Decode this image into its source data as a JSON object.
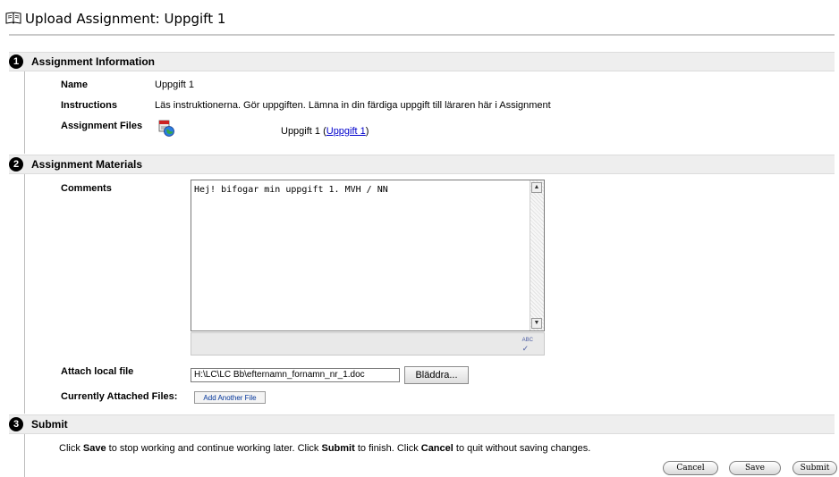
{
  "page": {
    "title": "Upload Assignment: Uppgift 1",
    "icon": "open-book-icon"
  },
  "sections": {
    "info": {
      "number": "1",
      "title": "Assignment Information"
    },
    "materials": {
      "number": "2",
      "title": "Assignment Materials"
    },
    "submit": {
      "number": "3",
      "title": "Submit"
    }
  },
  "info": {
    "name_label": "Name",
    "name_value": "Uppgift 1",
    "instructions_label": "Instructions",
    "instructions_value": "Läs instruktionerna. Gör uppgiften. Lämna in din färdiga uppgift till läraren här i Assignment",
    "files_label": "Assignment Files",
    "file_text": "Uppgift 1 (",
    "file_link": "Uppgift 1",
    "file_text_end": ")"
  },
  "materials": {
    "comments_label": "Comments",
    "comments_value": "Hej! bifogar min uppgift 1. MVH / NN",
    "attach_label": "Attach local file",
    "attach_value": "H:\\LC\\LC Bb\\efternamn_fornamn_nr_1.doc",
    "browse_label": "Bläddra...",
    "attached_label": "Currently Attached Files:",
    "add_file_label": "Add Another File",
    "spell_icon_text": "ABC"
  },
  "submit": {
    "instr_1": "Click ",
    "instr_save": "Save",
    "instr_2": " to stop working and continue working later. Click ",
    "instr_submit": "Submit",
    "instr_3": " to finish. Click ",
    "instr_cancel": "Cancel",
    "instr_4": " to quit without saving changes.",
    "cancel_label": "Cancel",
    "save_label": "Save",
    "submit_label": "Submit"
  }
}
